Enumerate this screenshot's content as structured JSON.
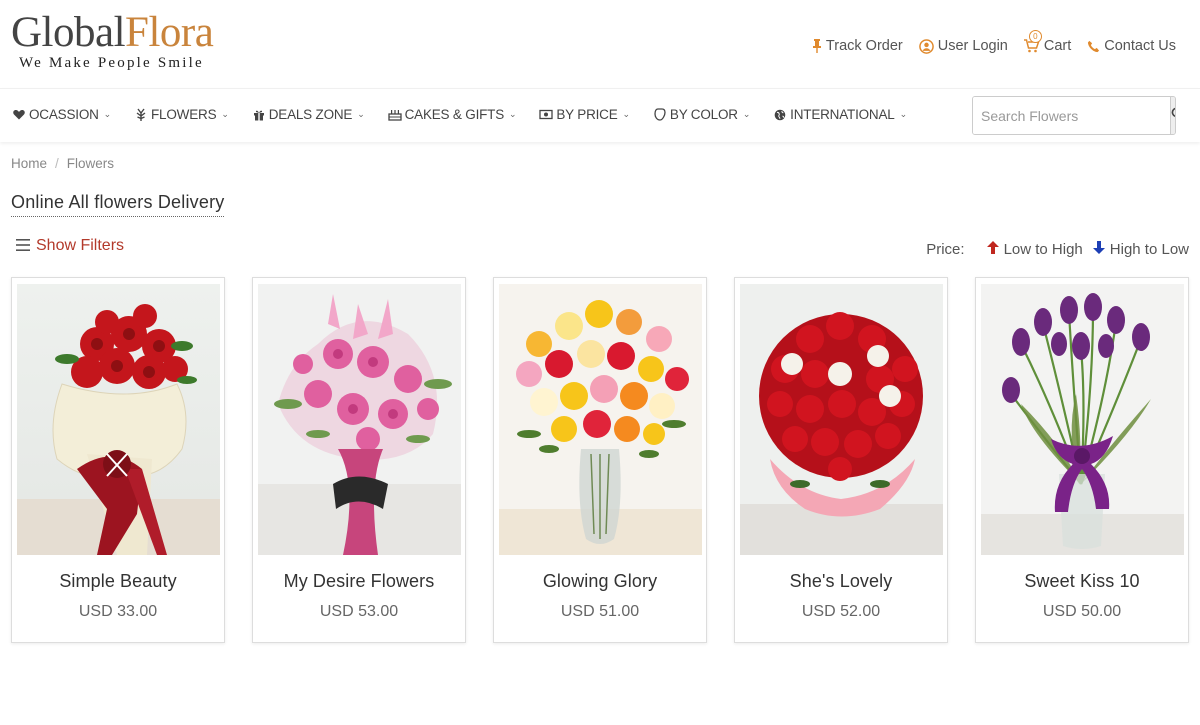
{
  "logo": {
    "part1": "Global",
    "part2": "Flora",
    "tagline": "We Make People Smile"
  },
  "top_links": [
    {
      "label": "Track Order",
      "icon": "pin-icon"
    },
    {
      "label": "User Login",
      "icon": "user-icon"
    },
    {
      "label": "Cart",
      "icon": "cart-icon",
      "count": "0"
    },
    {
      "label": "Contact Us",
      "icon": "phone-icon"
    }
  ],
  "nav": [
    {
      "label": "OCASSION",
      "icon": "heart-icon"
    },
    {
      "label": "FLOWERS",
      "icon": "flower-icon"
    },
    {
      "label": "DEALS ZONE",
      "icon": "gift-icon"
    },
    {
      "label": "CAKES & GIFTS",
      "icon": "cake-icon"
    },
    {
      "label": "BY PRICE",
      "icon": "money-icon"
    },
    {
      "label": "BY COLOR",
      "icon": "color-drop-icon"
    },
    {
      "label": "INTERNATIONAL",
      "icon": "globe-icon"
    }
  ],
  "search": {
    "placeholder": "Search Flowers"
  },
  "breadcrumb": [
    "Home",
    "Flowers"
  ],
  "page_title": "Online All flowers Delivery",
  "filters_label": "Show Filters",
  "sort": {
    "label": "Price:",
    "low_to_high": "Low to High",
    "high_to_low": "High to Low"
  },
  "products": [
    {
      "name": "Simple Beauty",
      "price": "USD 33.00"
    },
    {
      "name": "My Desire Flowers",
      "price": "USD 53.00"
    },
    {
      "name": "Glowing Glory",
      "price": "USD 51.00"
    },
    {
      "name": "She's Lovely",
      "price": "USD 52.00"
    },
    {
      "name": "Sweet Kiss 10",
      "price": "USD 50.00"
    }
  ],
  "colors": {
    "brand": "#c9843c",
    "accent": "#e08a2e",
    "filter": "#b33a2b",
    "up": "#c0271f",
    "down": "#1d3fb5"
  }
}
